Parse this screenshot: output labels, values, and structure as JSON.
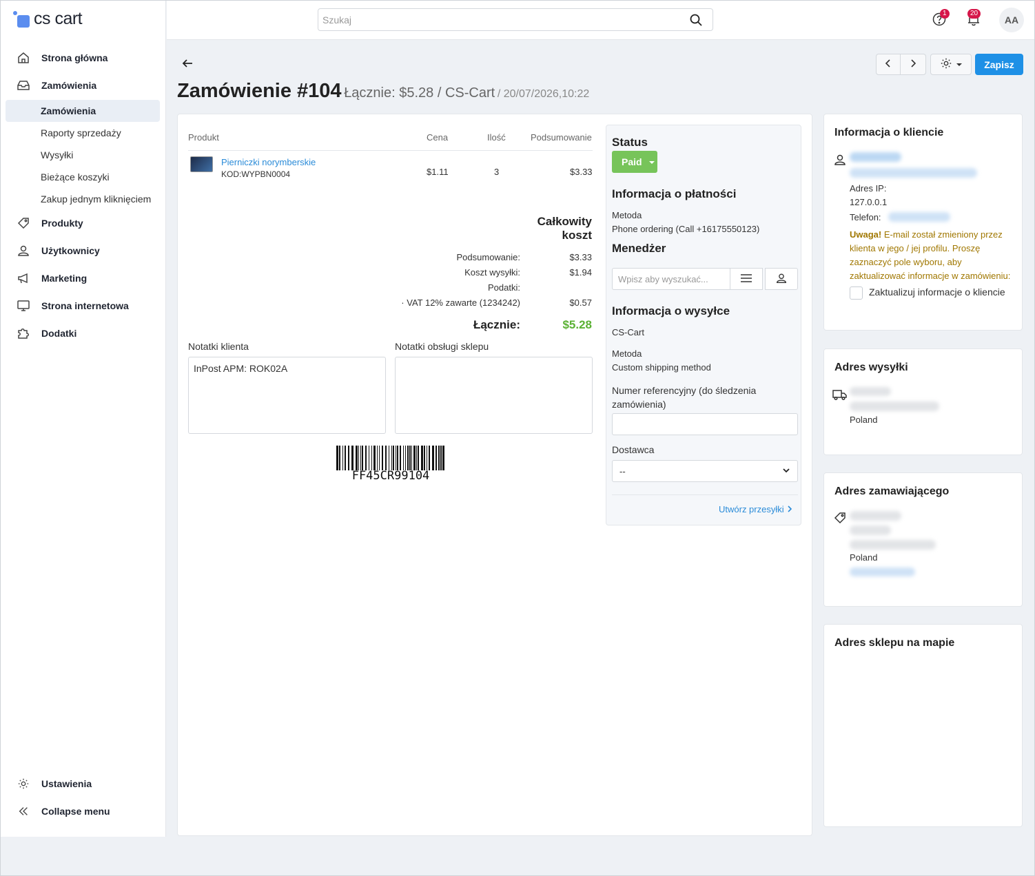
{
  "app": {
    "logo_text": "cs cart"
  },
  "sidebar": {
    "items": [
      {
        "label": "Strona główna",
        "icon": "home-icon"
      },
      {
        "label": "Zamówienia",
        "icon": "inbox-icon"
      },
      {
        "label": "Produkty",
        "icon": "tag-icon"
      },
      {
        "label": "Użytkownicy",
        "icon": "user-icon"
      },
      {
        "label": "Marketing",
        "icon": "megaphone-icon"
      },
      {
        "label": "Strona internetowa",
        "icon": "monitor-icon"
      },
      {
        "label": "Dodatki",
        "icon": "puzzle-icon"
      }
    ],
    "subitems": [
      "Zamówienia",
      "Raporty sprzedaży",
      "Wysyłki",
      "Bieżące koszyki",
      "Zakup jednym kliknięciem"
    ],
    "settings": "Ustawienia",
    "collapse": "Collapse menu"
  },
  "topbar": {
    "search_placeholder": "Szukaj",
    "help_badge": "1",
    "notif_badge": "20",
    "avatar": "AA"
  },
  "header": {
    "title": "Zamówienie #104",
    "total": "Łącznie: $5.28 / CS-Cart",
    "date": "/ 20/07/2026,10:22",
    "save": "Zapisz"
  },
  "products": {
    "headers": {
      "product": "Produkt",
      "price": "Cena",
      "qty": "Ilość",
      "subtotal": "Podsumowanie"
    },
    "rows": [
      {
        "name": "Pierniczki norymberskie",
        "code": "KOD:WYPBN0004",
        "price": "$1.11",
        "qty": "3",
        "subtotal": "$3.33"
      }
    ]
  },
  "totals": {
    "title": "Całkowity koszt",
    "subtotal_label": "Podsumowanie:",
    "subtotal": "$3.33",
    "shipping_label": "Koszt wysyłki:",
    "shipping": "$1.94",
    "taxes_label": "Podatki:",
    "vat_label": "· VAT 12% zawarte (1234242)",
    "vat": "$0.57",
    "total_label": "Łącznie:",
    "total": "$5.28",
    "total_color": "#5bb134"
  },
  "notes": {
    "customer_label": "Notatki klienta",
    "customer_value": "InPost APM: ROK02A",
    "staff_label": "Notatki obsługi sklepu",
    "staff_value": ""
  },
  "barcode": "FF45CR99104",
  "status": {
    "heading": "Status",
    "value": "Paid",
    "payment_heading": "Informacja o płatności",
    "method_label": "Metoda",
    "method_value": "Phone ordering (Call +16175550123)",
    "manager_heading": "Menedżer",
    "manager_placeholder": "Wpisz aby wyszukać...",
    "shipping_heading": "Informacja o wysyłce",
    "shipping_store": "CS-Cart",
    "shipping_method_label": "Metoda",
    "shipping_method_value": "Custom shipping method",
    "tracking_label": "Numer referencyjny (do śledzenia zamówienia)",
    "carrier_label": "Dostawca",
    "carrier_value": "--",
    "create_shipment": "Utwórz przesyłki"
  },
  "customer": {
    "heading": "Informacja o kliencie",
    "ip_label": "Adres IP:",
    "ip_value": "127.0.0.1",
    "phone_label": "Telefon:",
    "warning_bold": "Uwaga!",
    "warning_text": " E-mail został zmieniony przez klienta w jego / jej profilu. Proszę zaznaczyć pole wyboru, aby zaktualizować informacje w zamówieniu:",
    "update_label": "Zaktualizuj informacje o kliencie"
  },
  "shipping_address": {
    "heading": "Adres wysyłki",
    "country": "Poland"
  },
  "billing_address": {
    "heading": "Adres zamawiającego",
    "country": "Poland"
  },
  "map": {
    "heading": "Adres sklepu na mapie"
  }
}
